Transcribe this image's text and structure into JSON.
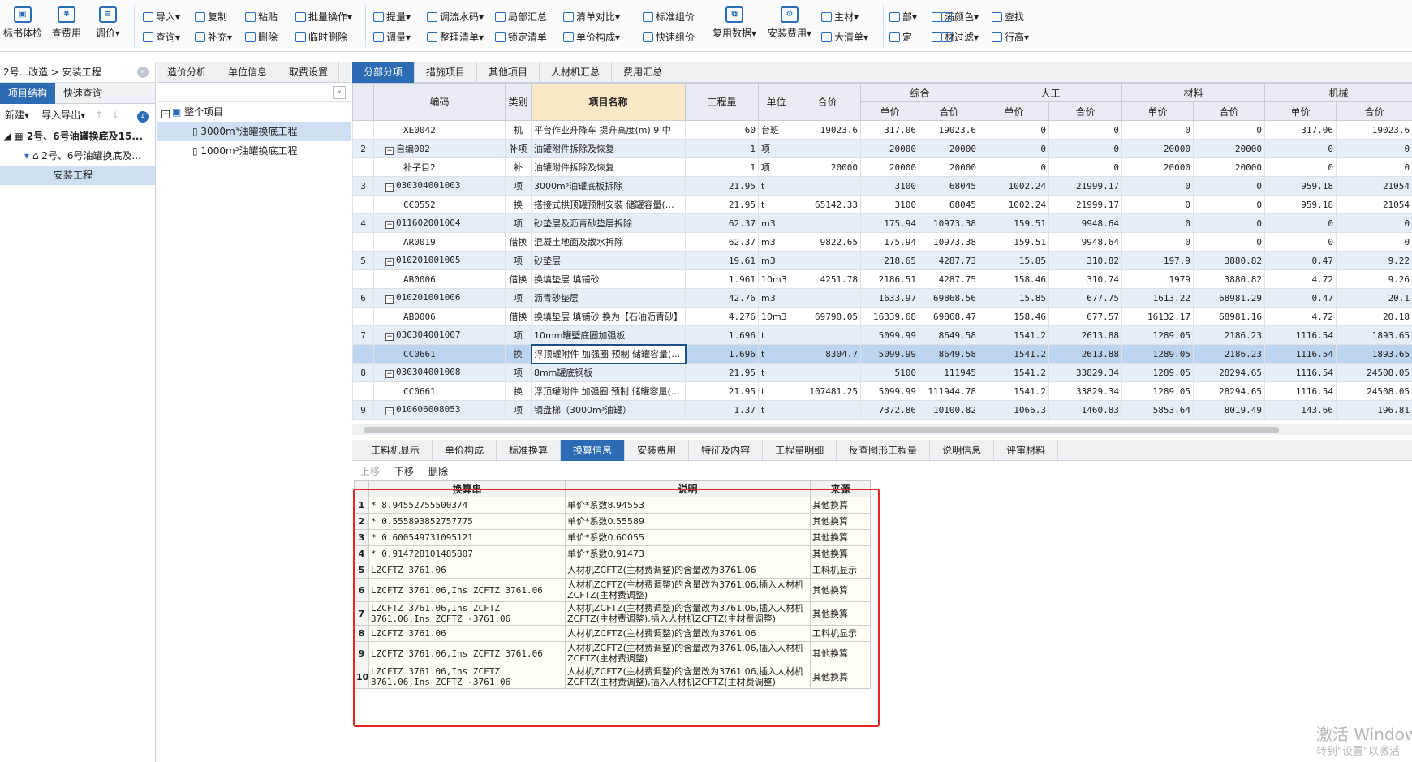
{
  "toolbar": {
    "big": [
      "标书体检",
      "查费用",
      "调价▾",
      "复用数据▾",
      "安装费用▾"
    ],
    "col1": [
      "导入▾",
      "复制",
      "粘贴",
      "批量操作▾",
      "查询▾",
      "补充▾",
      "删除",
      "临时删除"
    ],
    "col2": [
      "提量▾",
      "调流水码▾",
      "局部汇总",
      "清单对比▾",
      "调量▾",
      "整理清单▾",
      "锁定清单",
      "单价构成▾"
    ],
    "col3": [
      "标准组价",
      "快速组价"
    ],
    "col4": [
      "主材▾",
      "大清单▾"
    ],
    "col5": [
      "部▾",
      "满",
      "颜色▾",
      "查找",
      "定",
      "材",
      "过滤▾",
      "行高▾"
    ]
  },
  "left": {
    "breadcrumb": "2号...改造 > 安装工程",
    "tabs": [
      "项目结构",
      "快速查询"
    ],
    "tools": [
      "新建▾",
      "导入导出▾"
    ],
    "tree": [
      "2号、6号油罐换底及15...",
      "2号、6号油罐换底及...",
      "安装工程"
    ]
  },
  "mid": {
    "tabs": [
      "造价分析",
      "单位信息",
      "取费设置"
    ],
    "root": "整个项目",
    "children": [
      "3000m³油罐换底工程",
      "1000m³油罐换底工程"
    ]
  },
  "main_tabs": [
    "分部分项",
    "措施项目",
    "其他项目",
    "人材机汇总",
    "费用汇总"
  ],
  "grid": {
    "headers": {
      "code": "编码",
      "type": "类别",
      "name": "项目名称",
      "qty": "工程量",
      "unit": "单位",
      "total": "合价",
      "g1": "综合",
      "g2": "人工",
      "g3": "材料",
      "g4": "机械",
      "up": "单价",
      "tp": "合价"
    },
    "rows": [
      {
        "no": "",
        "code": "XE0042",
        "type": "机",
        "name": "平台作业升降车 提升高度(m) 9 中",
        "qty": "60",
        "unit": "台班",
        "total": "19023.6",
        "c1": "317.06",
        "c2": "19023.6",
        "l1": "0",
        "l2": "0",
        "m1": "0",
        "m2": "0",
        "j1": "317.06",
        "j2": "19023.6",
        "lvl": "child"
      },
      {
        "no": "2",
        "code": "自编002",
        "type": "补项",
        "name": "油罐附件拆除及恢复",
        "qty": "1",
        "unit": "项",
        "total": "",
        "c1": "20000",
        "c2": "20000",
        "l1": "0",
        "l2": "0",
        "m1": "20000",
        "m2": "20000",
        "j1": "0",
        "j2": "0",
        "lvl": "parent"
      },
      {
        "no": "",
        "code": "补子目2",
        "type": "补",
        "name": "油罐附件拆除及恢复",
        "qty": "1",
        "unit": "项",
        "total": "20000",
        "c1": "20000",
        "c2": "20000",
        "l1": "0",
        "l2": "0",
        "m1": "20000",
        "m2": "20000",
        "j1": "0",
        "j2": "0",
        "lvl": "child"
      },
      {
        "no": "3",
        "code": "030304001003",
        "type": "项",
        "name": "3000m³油罐底板拆除",
        "qty": "21.95",
        "unit": "t",
        "total": "",
        "c1": "3100",
        "c2": "68045",
        "l1": "1002.24",
        "l2": "21999.17",
        "m1": "0",
        "m2": "0",
        "j1": "959.18",
        "j2": "21054",
        "lvl": "parent"
      },
      {
        "no": "",
        "code": "CC0552",
        "type": "换",
        "name": "搭接式拱顶罐预制安装 储罐容量(m3…",
        "qty": "21.95",
        "unit": "t",
        "total": "65142.33",
        "c1": "3100",
        "c2": "68045",
        "l1": "1002.24",
        "l2": "21999.17",
        "m1": "0",
        "m2": "0",
        "j1": "959.18",
        "j2": "21054",
        "lvl": "child"
      },
      {
        "no": "4",
        "code": "011602001004",
        "type": "项",
        "name": "砂垫层及沥青砂垫层拆除",
        "qty": "62.37",
        "unit": "m3",
        "total": "",
        "c1": "175.94",
        "c2": "10973.38",
        "l1": "159.51",
        "l2": "9948.64",
        "m1": "0",
        "m2": "0",
        "j1": "0",
        "j2": "0",
        "lvl": "parent"
      },
      {
        "no": "",
        "code": "AR0019",
        "type": "借换",
        "name": "混凝土地面及散水拆除",
        "qty": "62.37",
        "unit": "m3",
        "total": "9822.65",
        "c1": "175.94",
        "c2": "10973.38",
        "l1": "159.51",
        "l2": "9948.64",
        "m1": "0",
        "m2": "0",
        "j1": "0",
        "j2": "0",
        "lvl": "child"
      },
      {
        "no": "5",
        "code": "010201001005",
        "type": "项",
        "name": "砂垫层",
        "qty": "19.61",
        "unit": "m3",
        "total": "",
        "c1": "218.65",
        "c2": "4287.73",
        "l1": "15.85",
        "l2": "310.82",
        "m1": "197.9",
        "m2": "3880.82",
        "j1": "0.47",
        "j2": "9.22",
        "lvl": "parent"
      },
      {
        "no": "",
        "code": "AB0006",
        "type": "借换",
        "name": "换填垫层 填铺砂",
        "qty": "1.961",
        "unit": "10m3",
        "total": "4251.78",
        "c1": "2186.51",
        "c2": "4287.75",
        "l1": "158.46",
        "l2": "310.74",
        "m1": "1979",
        "m2": "3880.82",
        "j1": "4.72",
        "j2": "9.26",
        "lvl": "child"
      },
      {
        "no": "6",
        "code": "010201001006",
        "type": "项",
        "name": "沥青砂垫层",
        "qty": "42.76",
        "unit": "m3",
        "total": "",
        "c1": "1633.97",
        "c2": "69868.56",
        "l1": "15.85",
        "l2": "677.75",
        "m1": "1613.22",
        "m2": "68981.29",
        "j1": "0.47",
        "j2": "20.1",
        "lvl": "parent"
      },
      {
        "no": "",
        "code": "AB0006",
        "type": "借换",
        "name": "换填垫层 填铺砂  换为【石油沥青砂】",
        "qty": "4.276",
        "unit": "10m3",
        "total": "69790.05",
        "c1": "16339.68",
        "c2": "69868.47",
        "l1": "158.46",
        "l2": "677.57",
        "m1": "16132.17",
        "m2": "68981.16",
        "j1": "4.72",
        "j2": "20.18",
        "lvl": "child"
      },
      {
        "no": "7",
        "code": "030304001007",
        "type": "项",
        "name": "10mm罐壁底圈加强板",
        "qty": "1.696",
        "unit": "t",
        "total": "",
        "c1": "5099.99",
        "c2": "8649.58",
        "l1": "1541.2",
        "l2": "2613.88",
        "m1": "1289.05",
        "m2": "2186.23",
        "j1": "1116.54",
        "j2": "1893.65",
        "lvl": "parent"
      },
      {
        "no": "",
        "code": "CC0661",
        "type": "换",
        "name": "浮顶罐附件 加强圈 预制 储罐容量(m…",
        "qty": "1.696",
        "unit": "t",
        "total": "8304.7",
        "c1": "5099.99",
        "c2": "8649.58",
        "l1": "1541.2",
        "l2": "2613.88",
        "m1": "1289.05",
        "m2": "2186.23",
        "j1": "1116.54",
        "j2": "1893.65",
        "lvl": "sel"
      },
      {
        "no": "8",
        "code": "030304001008",
        "type": "项",
        "name": "8mm罐底钢板",
        "qty": "21.95",
        "unit": "t",
        "total": "",
        "c1": "5100",
        "c2": "111945",
        "l1": "1541.2",
        "l2": "33829.34",
        "m1": "1289.05",
        "m2": "28294.65",
        "j1": "1116.54",
        "j2": "24508.05",
        "lvl": "parent"
      },
      {
        "no": "",
        "code": "CC0661",
        "type": "换",
        "name": "浮顶罐附件 加强圈 预制 储罐容量(m…",
        "qty": "21.95",
        "unit": "t",
        "total": "107481.25",
        "c1": "5099.99",
        "c2": "111944.78",
        "l1": "1541.2",
        "l2": "33829.34",
        "m1": "1289.05",
        "m2": "28294.65",
        "j1": "1116.54",
        "j2": "24508.05",
        "lvl": "child"
      },
      {
        "no": "9",
        "code": "010606008053",
        "type": "项",
        "name": "钢盘梯（3000m³油罐）",
        "qty": "1.37",
        "unit": "t",
        "total": "",
        "c1": "7372.86",
        "c2": "10100.82",
        "l1": "1066.3",
        "l2": "1460.83",
        "m1": "5853.64",
        "m2": "8019.49",
        "j1": "143.66",
        "j2": "196.81",
        "lvl": "parent"
      }
    ]
  },
  "bottom_tabs": [
    "工料机显示",
    "单价构成",
    "标准换算",
    "换算信息",
    "安装费用",
    "特征及内容",
    "工程量明细",
    "反查图形工程量",
    "说明信息",
    "评审材料"
  ],
  "bottom_tools": [
    "上移",
    "下移",
    "删除"
  ],
  "conv": {
    "headers": [
      "换算串",
      "说明",
      "来源"
    ],
    "rows": [
      {
        "idx": "1",
        "str": "* 8.94552755500374",
        "desc": "单价*系数8.94553",
        "src": "其他换算"
      },
      {
        "idx": "2",
        "str": "* 0.555893852757775",
        "desc": "单价*系数0.55589",
        "src": "其他换算"
      },
      {
        "idx": "3",
        "str": "* 0.600549731095121",
        "desc": "单价*系数0.60055",
        "src": "其他换算"
      },
      {
        "idx": "4",
        "str": "* 0.914728101485807",
        "desc": "单价*系数0.91473",
        "src": "其他换算"
      },
      {
        "idx": "5",
        "str": "LZCFTZ 3761.06",
        "desc": "人材机ZCFTZ(主材费调整)的含量改为3761.06",
        "src": "工料机显示"
      },
      {
        "idx": "6",
        "str": "LZCFTZ 3761.06,Ins ZCFTZ 3761.06",
        "desc": "人材机ZCFTZ(主材费调整)的含量改为3761.06,插入人材机ZCFTZ(主材费调整)",
        "src": "其他换算"
      },
      {
        "idx": "7",
        "str": "LZCFTZ 3761.06,Ins ZCFTZ 3761.06,Ins ZCFTZ -3761.06",
        "desc": "人材机ZCFTZ(主材费调整)的含量改为3761.06,插入人材机ZCFTZ(主材费调整),插入人材机ZCFTZ(主材费调整)",
        "src": "其他换算"
      },
      {
        "idx": "8",
        "str": "LZCFTZ 3761.06",
        "desc": "人材机ZCFTZ(主材费调整)的含量改为3761.06",
        "src": "工料机显示"
      },
      {
        "idx": "9",
        "str": "LZCFTZ 3761.06,Ins ZCFTZ 3761.06",
        "desc": "人材机ZCFTZ(主材费调整)的含量改为3761.06,插入人材机ZCFTZ(主材费调整)",
        "src": "其他换算"
      },
      {
        "idx": "10",
        "str": "LZCFTZ 3761.06,Ins ZCFTZ 3761.06,Ins ZCFTZ -3761.06",
        "desc": "人材机ZCFTZ(主材费调整)的含量改为3761.06,插入人材机ZCFTZ(主材费调整),插入人材机ZCFTZ(主材费调整)",
        "src": "其他换算"
      }
    ]
  },
  "watermark": [
    "激活 Windows",
    "转到\"设置\"以激活"
  ]
}
